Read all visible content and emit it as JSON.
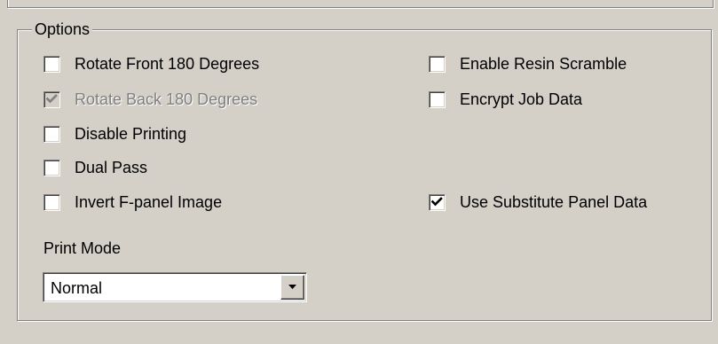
{
  "options": {
    "title": "Options",
    "checkboxes": [
      {
        "label": "Rotate Front 180 Degrees",
        "checked": false,
        "enabled": true
      },
      {
        "label": "Rotate Back 180 Degrees",
        "checked": true,
        "enabled": false
      },
      {
        "label": "Disable Printing",
        "checked": false,
        "enabled": true
      },
      {
        "label": "Dual Pass",
        "checked": false,
        "enabled": true
      },
      {
        "label": "Invert F-panel Image",
        "checked": false,
        "enabled": true
      },
      {
        "label": "Enable Resin Scramble",
        "checked": false,
        "enabled": true
      },
      {
        "label": "Encrypt Job Data",
        "checked": false,
        "enabled": true
      },
      {
        "label": "Use Substitute Panel Data",
        "checked": true,
        "enabled": true
      }
    ],
    "print_mode": {
      "label": "Print Mode",
      "selected": "Normal"
    }
  }
}
